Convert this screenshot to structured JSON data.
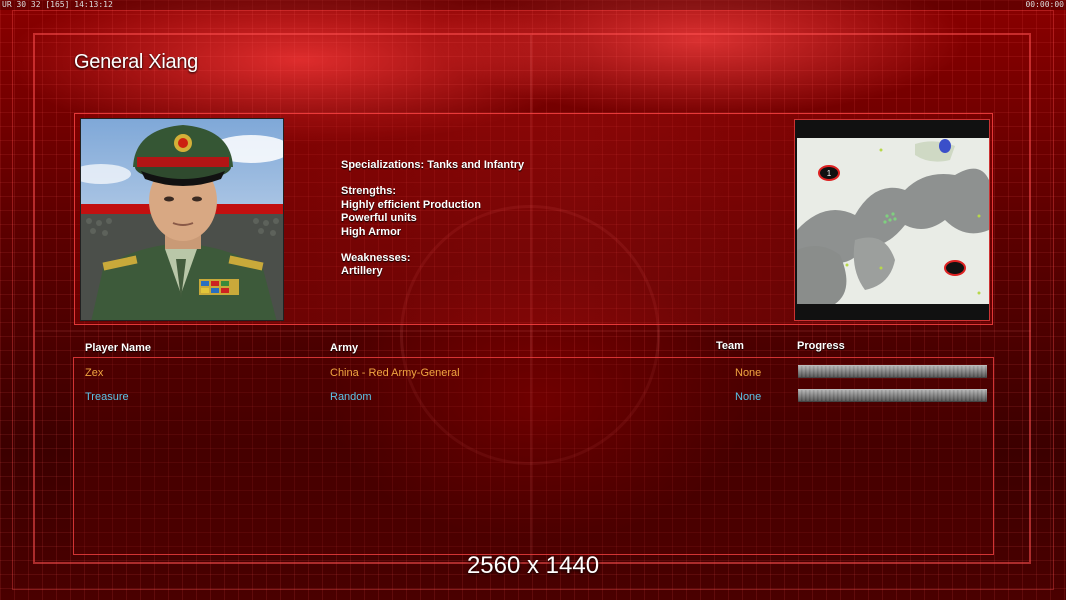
{
  "topbar": {
    "left_text": "UR 30 32 [165] 14:13:12",
    "right_text": "00:00:00"
  },
  "general": {
    "title": "General Xiang",
    "specializations": "Specializations: Tanks and Infantry",
    "strengths_heading": "Strengths:",
    "strengths": [
      "Highly efficient Production",
      "Powerful units",
      "High Armor"
    ],
    "weaknesses_heading": "Weaknesses:",
    "weaknesses": [
      "Artillery"
    ]
  },
  "minimap": {
    "start_markers": [
      "1",
      ""
    ]
  },
  "table": {
    "headers": {
      "player": "Player Name",
      "army": "Army",
      "team": "Team",
      "progress": "Progress"
    },
    "rows": [
      {
        "player": "Zex",
        "army": "China - Red Army-General",
        "team": "None",
        "progress": 1.0,
        "color": "#f0a540"
      },
      {
        "player": "Treasure",
        "army": "Random",
        "team": "None",
        "progress": 1.0,
        "color": "#5cc4e8"
      }
    ]
  },
  "resolution_label": "2560 x 1440",
  "colors": {
    "accent": "#ff3b3b",
    "player_orange": "#f0a540",
    "player_cyan": "#5cc4e8"
  }
}
